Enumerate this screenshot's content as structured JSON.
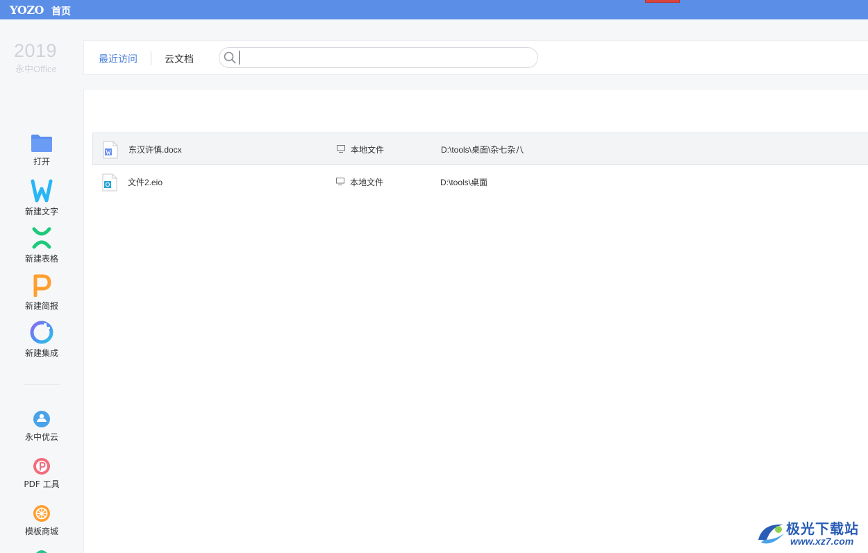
{
  "titlebar": {
    "logo": "YOZO",
    "home": "首页"
  },
  "brand": {
    "year": "2019",
    "name": "永中Office"
  },
  "sidebar": {
    "actions": [
      {
        "label": "打开",
        "icon": "folder-icon"
      },
      {
        "label": "新建文字",
        "icon": "word-icon"
      },
      {
        "label": "新建表格",
        "icon": "spreadsheet-icon"
      },
      {
        "label": "新建简报",
        "icon": "presentation-icon"
      },
      {
        "label": "新建集成",
        "icon": "integrated-icon"
      }
    ],
    "services": [
      {
        "label": "永中优云",
        "icon": "cloud-service-icon"
      },
      {
        "label": "PDF 工具",
        "icon": "pdf-icon"
      },
      {
        "label": "模板商城",
        "icon": "template-store-icon"
      }
    ]
  },
  "tabs": {
    "recent": "最近访问",
    "cloud": "云文档"
  },
  "search": {
    "value": "",
    "placeholder": ""
  },
  "files": [
    {
      "name": "东汉许慎.docx",
      "location": "本地文件",
      "path": "D:\\tools\\桌面\\杂七杂八",
      "type": "doc"
    },
    {
      "name": "文件2.eio",
      "location": "本地文件",
      "path": "D:\\tools\\桌面",
      "type": "eio"
    }
  ],
  "watermark": {
    "title": "极光下载站",
    "url": "www.xz7.com"
  },
  "colors": {
    "titlebar": "#5b8ee6",
    "accent": "#4a7fd9",
    "word": "#29b6f6",
    "spreadsheet": "#1ec97a",
    "presentation": "#ff9f2e"
  }
}
